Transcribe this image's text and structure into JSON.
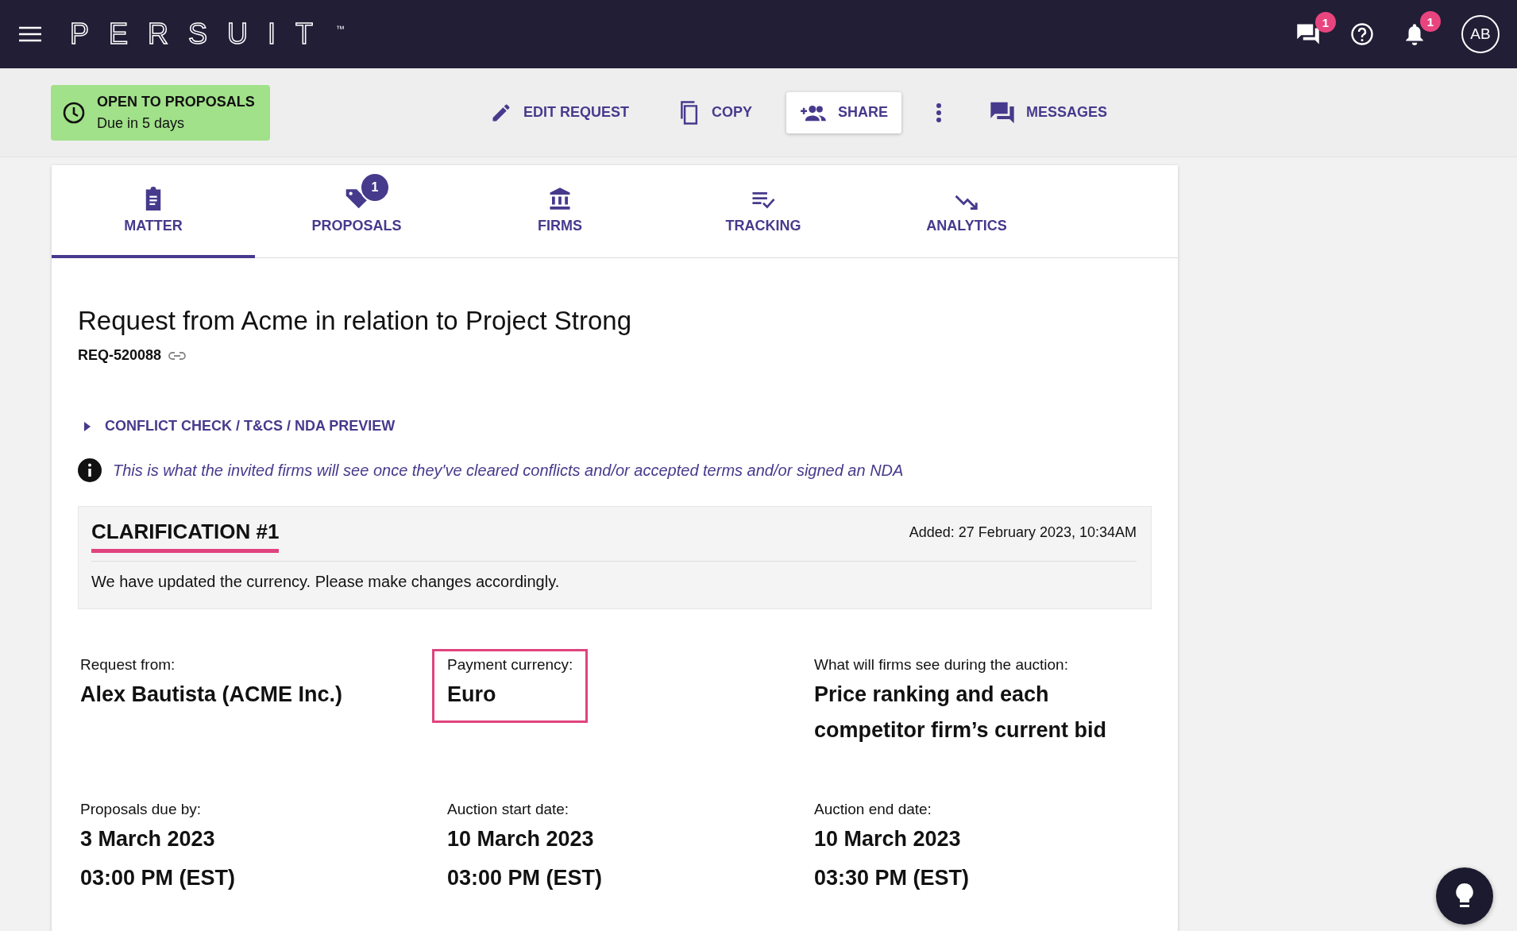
{
  "header": {
    "logo": "PERSUIT",
    "logo_mark": "™",
    "messages_badge": "1",
    "notifications_badge": "1",
    "avatar": "AB"
  },
  "status": {
    "title": "OPEN TO PROPOSALS",
    "subtitle": "Due in 5 days"
  },
  "actions": [
    {
      "kind": "edit",
      "label": "EDIT REQUEST",
      "raised": false
    },
    {
      "kind": "copy",
      "label": "COPY",
      "raised": false
    },
    {
      "kind": "share",
      "label": "SHARE",
      "raised": true
    },
    {
      "kind": "more",
      "raised": false
    },
    {
      "kind": "messages",
      "label": "MESSAGES",
      "raised": false
    }
  ],
  "tabs": [
    {
      "kind": "matter",
      "label": "MATTER",
      "selected": true
    },
    {
      "kind": "proposals",
      "label": "PROPOSALS",
      "selected": false,
      "badge": "1"
    },
    {
      "kind": "firms",
      "label": "FIRMS",
      "selected": false
    },
    {
      "kind": "tracking",
      "label": "TRACKING",
      "selected": false
    },
    {
      "kind": "analytics",
      "label": "ANALYTICS",
      "selected": false
    }
  ],
  "request": {
    "title": "Request from Acme in relation to Project Strong",
    "reference": "REQ-520088",
    "disclosure": {
      "label": "CONFLICT CHECK / T&CS / NDA PREVIEW",
      "expanded": false
    },
    "notice": "This is what the invited firms will see once they've cleared conflicts and/or accepted terms and/or signed an NDA"
  },
  "clarification": {
    "title": "CLARIFICATION #1",
    "added": "Added: 27 February 2023, 10:34AM",
    "message": "We have updated the currency. Please make changes accordingly."
  },
  "details": [
    {
      "label": "Request from:",
      "lines": [
        "Alex Bautista (ACME Inc.)"
      ],
      "highlighted": false
    },
    {
      "label": "Payment currency:",
      "lines": [
        "Euro"
      ],
      "highlighted": true
    },
    {
      "label": "What will firms see during the auction:",
      "lines": [
        "Price ranking and each competitor firm’s current bid"
      ],
      "highlighted": false
    },
    {
      "label": "Proposals due by:",
      "lines": [
        "3 March 2023",
        "03:00 PM (EST)"
      ],
      "highlighted": false
    },
    {
      "label": "Auction start date:",
      "lines": [
        "10 March 2023",
        "03:00 PM (EST)"
      ],
      "highlighted": false
    },
    {
      "label": "Auction end date:",
      "lines": [
        "10 March 2023",
        "03:30 PM (EST)"
      ],
      "highlighted": false
    }
  ]
}
